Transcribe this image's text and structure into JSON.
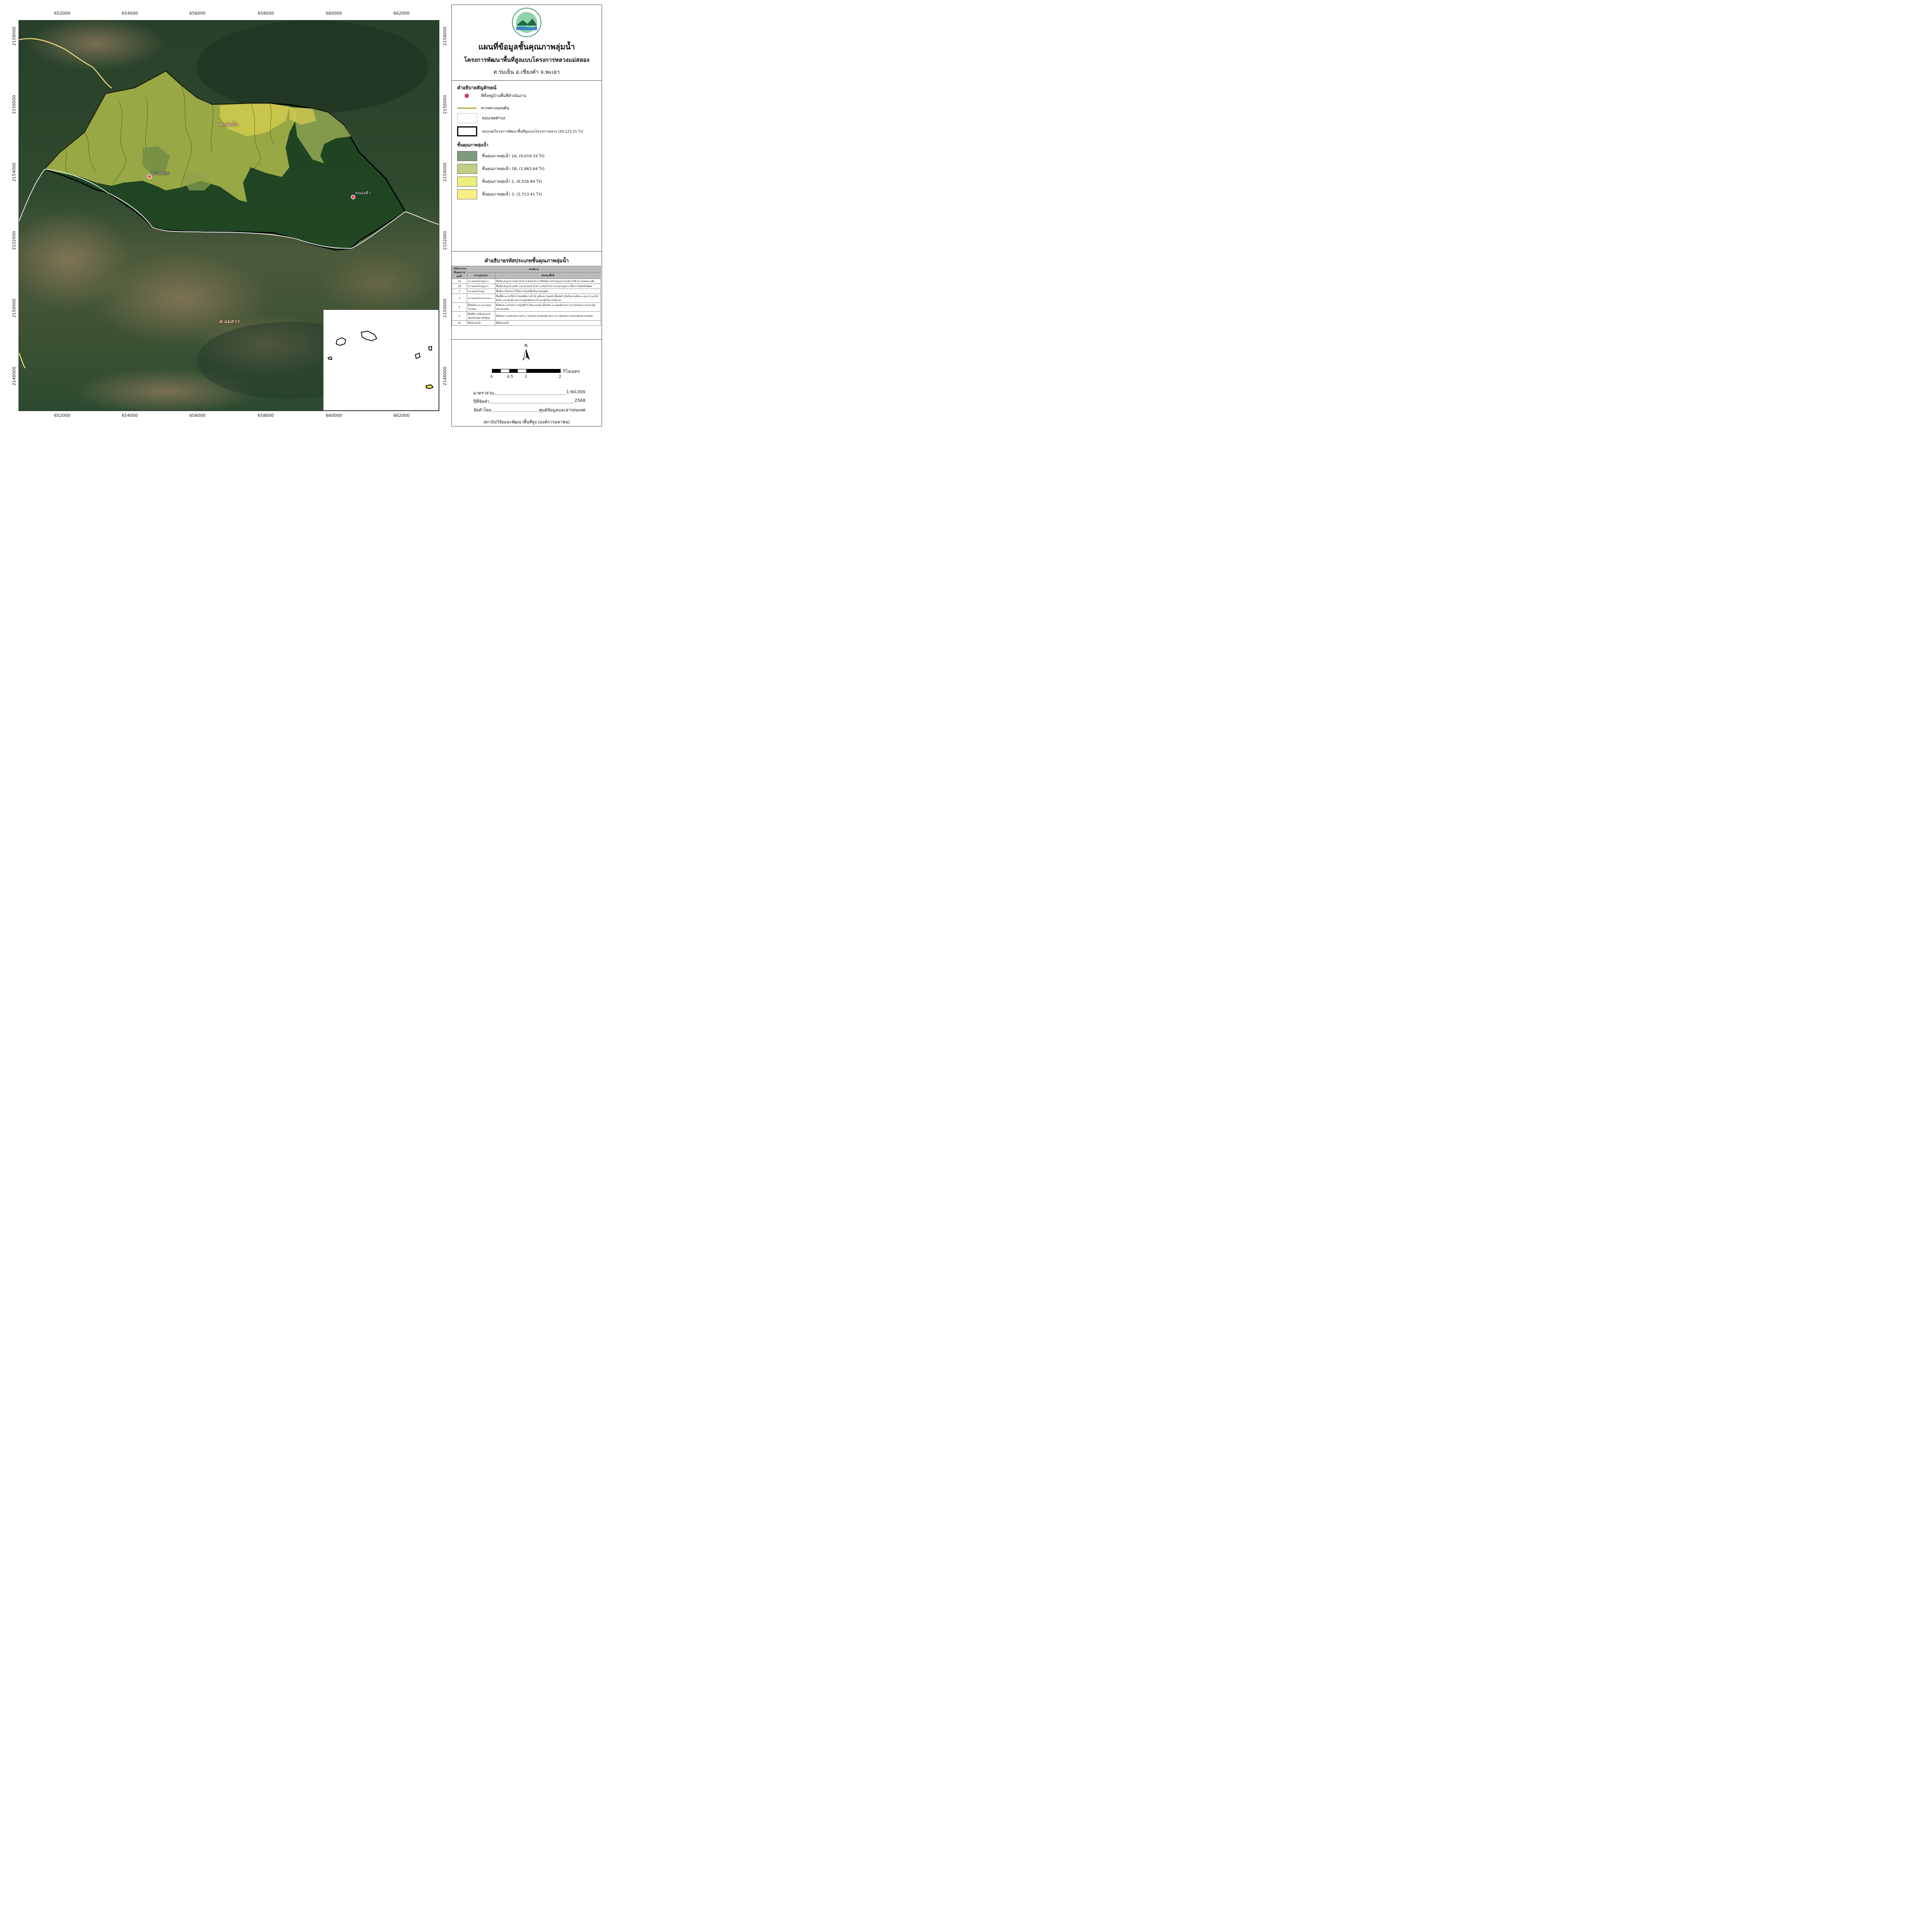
{
  "header": {
    "map_title": "แผนที่ข้อมูลชั้นคุณภาพลุ่มน้ำ",
    "project": "โครงการพัฒนาพื้นที่สูงแบบโครงการหลวงแม่สลอง",
    "location": "ต.ร่มเย็น อ.เชียงคำ จ.พะเยา"
  },
  "grid": {
    "x_ticks": [
      "652000",
      "654000",
      "656000",
      "658000",
      "660000",
      "662000"
    ],
    "y_ticks": [
      "2158000",
      "2156000",
      "2154000",
      "2152000",
      "2150000",
      "2148000"
    ]
  },
  "map_labels": {
    "village_1": "ผาแดงบน",
    "village_2": "หนองห้า",
    "tambon_1": "ต.ร่มเย็น",
    "tambon_2": "ต.แม่ลาว"
  },
  "legend": {
    "title": "คำอธิบายสัญลักษณ์",
    "items": [
      {
        "label": "ที่ตั้งหมู่บ้านพื้นที่ดำเนินงาน",
        "icon": "village-marker"
      },
      {
        "label": "ทางหลวงแผ่นดิน",
        "icon": "highway-line"
      },
      {
        "label": "ขอบเขตตำบล",
        "icon": "tambon-boundary"
      },
      {
        "label": "ขอบเขตโครงการพัฒนาพื้นที่สูงแบบโครงการหลวง (20,123.21 ไร่)",
        "icon": "project-boundary"
      }
    ],
    "class_title": "ชั้นคุณภาพลุ่มน้ำ",
    "classes": [
      {
        "label": "ชั้นคุณภาพลุ่มน้ำ  1A, (9,019.33 ไร่)",
        "color": "#7f9a7c"
      },
      {
        "label": "ชั้นคุณภาพลุ่มน้ำ  1B, (1,863.64 ไร่)",
        "color": "#bfcf85"
      },
      {
        "label": "ชั้นคุณภาพลุ่มน้ำ  2, (6,526.84 ไร่)",
        "color": "#e9ef7d"
      },
      {
        "label": "ชั้นคุณภาพลุ่มน้ำ  3, (2,713.41 ไร่)",
        "color": "#f9ee84"
      }
    ]
  },
  "code_table": {
    "title": "คำอธิบายรหัสประเภทชั้นคุณภาพลุ่มน้ำ",
    "head_code": "รหัสประเภท ชั้นคุณภาพ ลุ่มน้ำ",
    "head_desc": "คำอธิบาย",
    "head_sens": "ความอ่อนไหว",
    "head_char": "ลักษณะพื้นที่",
    "rows": [
      {
        "code": "1A",
        "sens": "ความอ่อนไหวสูงมาก",
        "desc": "พื้นที่ป่าสมบูรณ์ ก่อนปี 2525 ป่าต้นน้ำลำธารที่ยังมีสภาพป่าสมบูรณ์ ห้ามมีการใช้ ประโยชน์อย่างอื่น"
      },
      {
        "code": "1B",
        "sens": "ความอ่อนไหวสูงมาก",
        "desc": "พื้นที่ป่าสมบูรณ์ แต่มีการบุกรุกก่อนปี 2525 ป่าต้นน้ำลำธารแบบควบคุมการใช้ประโยชน์เป็นพิเศษ"
      },
      {
        "code": "2",
        "sens": "ความอ่อนไหวสูง",
        "desc": "พื้นที่ควรเก็บรักษาไว้ใช้ประโยชน์เพื่อเป็นป่าเศรษฐกิจ"
      },
      {
        "code": "3",
        "sens": "ความอ่อนไหวปานกลาง",
        "desc": "พื้นที่ที่สามารถใช้ประโยชน์เพื่อการทำไม้ เหมืองแร่ ทุ่งหญ้าเลี้ยงสัตว์ หรือกิจกรรมที่เหมาะสม ประเภทไม้ยืนต้น และต้องมีมาตรการอนุรักษ์ดินและน้ำควบคู่ไปอย่างเข้มงวด"
      },
      {
        "code": "4",
        "sens": "พื้นที่เนินราบ ความอ่อนไหวน้อย",
        "desc": "พื้นที่เหมาะสำหรับการปลูกพืชไร่ ไม้ผล ทุ่งหญ้าเลี้ยงสัตว์ และต้องมีมาตรการการป้องกันการชะล้างพังทลายของดิน"
      },
      {
        "code": "5",
        "sens": "พื้นที่ที่ราบหรือเนินลาดเอียงเล็กน้อย หรือที่ลุ่ม",
        "desc": "พื้นที่เหมาะสมสำหรับการทำนา โดยไม่จำเป็นต้องมีมาตรการการป้องกันการชะล้างพังทลายของดิน"
      },
      {
        "code": "W",
        "sens": "พื้นที่แหล่งน้ำ",
        "desc": "พื้นที่แหล่งน้ำ"
      }
    ]
  },
  "scalebar": {
    "labels": [
      "0",
      "0.5",
      "1",
      "2"
    ],
    "unit": "กิโลเมตร",
    "north": "N"
  },
  "info": {
    "scale_label": "มาตราส่วน",
    "scale_value": "1:60,000",
    "year_label": "ปีที่จัดทำ",
    "year_value": "2568",
    "maker_label": "จัดทำโดย",
    "maker_value": "ศูนย์ข้อมูลและสารสนเทศ",
    "org": "สถาบันวิจัยและพัฒนาพื้นที่สูง (องค์การมหาชน)"
  }
}
